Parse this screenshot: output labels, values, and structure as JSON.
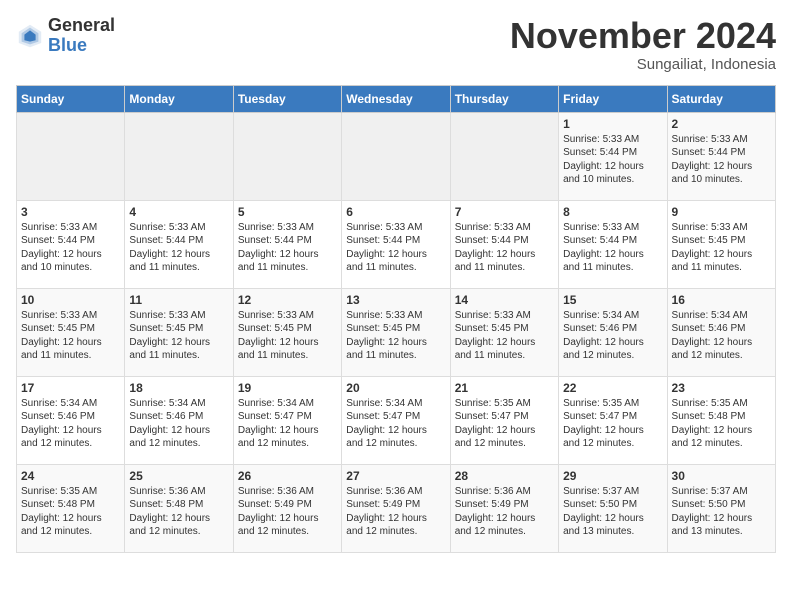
{
  "header": {
    "logo_general": "General",
    "logo_blue": "Blue",
    "month_title": "November 2024",
    "location": "Sungailiat, Indonesia"
  },
  "days_of_week": [
    "Sunday",
    "Monday",
    "Tuesday",
    "Wednesday",
    "Thursday",
    "Friday",
    "Saturday"
  ],
  "weeks": [
    [
      {
        "day": "",
        "text": ""
      },
      {
        "day": "",
        "text": ""
      },
      {
        "day": "",
        "text": ""
      },
      {
        "day": "",
        "text": ""
      },
      {
        "day": "",
        "text": ""
      },
      {
        "day": "1",
        "text": "Sunrise: 5:33 AM\nSunset: 5:44 PM\nDaylight: 12 hours\nand 10 minutes."
      },
      {
        "day": "2",
        "text": "Sunrise: 5:33 AM\nSunset: 5:44 PM\nDaylight: 12 hours\nand 10 minutes."
      }
    ],
    [
      {
        "day": "3",
        "text": "Sunrise: 5:33 AM\nSunset: 5:44 PM\nDaylight: 12 hours\nand 10 minutes."
      },
      {
        "day": "4",
        "text": "Sunrise: 5:33 AM\nSunset: 5:44 PM\nDaylight: 12 hours\nand 11 minutes."
      },
      {
        "day": "5",
        "text": "Sunrise: 5:33 AM\nSunset: 5:44 PM\nDaylight: 12 hours\nand 11 minutes."
      },
      {
        "day": "6",
        "text": "Sunrise: 5:33 AM\nSunset: 5:44 PM\nDaylight: 12 hours\nand 11 minutes."
      },
      {
        "day": "7",
        "text": "Sunrise: 5:33 AM\nSunset: 5:44 PM\nDaylight: 12 hours\nand 11 minutes."
      },
      {
        "day": "8",
        "text": "Sunrise: 5:33 AM\nSunset: 5:44 PM\nDaylight: 12 hours\nand 11 minutes."
      },
      {
        "day": "9",
        "text": "Sunrise: 5:33 AM\nSunset: 5:45 PM\nDaylight: 12 hours\nand 11 minutes."
      }
    ],
    [
      {
        "day": "10",
        "text": "Sunrise: 5:33 AM\nSunset: 5:45 PM\nDaylight: 12 hours\nand 11 minutes."
      },
      {
        "day": "11",
        "text": "Sunrise: 5:33 AM\nSunset: 5:45 PM\nDaylight: 12 hours\nand 11 minutes."
      },
      {
        "day": "12",
        "text": "Sunrise: 5:33 AM\nSunset: 5:45 PM\nDaylight: 12 hours\nand 11 minutes."
      },
      {
        "day": "13",
        "text": "Sunrise: 5:33 AM\nSunset: 5:45 PM\nDaylight: 12 hours\nand 11 minutes."
      },
      {
        "day": "14",
        "text": "Sunrise: 5:33 AM\nSunset: 5:45 PM\nDaylight: 12 hours\nand 11 minutes."
      },
      {
        "day": "15",
        "text": "Sunrise: 5:34 AM\nSunset: 5:46 PM\nDaylight: 12 hours\nand 12 minutes."
      },
      {
        "day": "16",
        "text": "Sunrise: 5:34 AM\nSunset: 5:46 PM\nDaylight: 12 hours\nand 12 minutes."
      }
    ],
    [
      {
        "day": "17",
        "text": "Sunrise: 5:34 AM\nSunset: 5:46 PM\nDaylight: 12 hours\nand 12 minutes."
      },
      {
        "day": "18",
        "text": "Sunrise: 5:34 AM\nSunset: 5:46 PM\nDaylight: 12 hours\nand 12 minutes."
      },
      {
        "day": "19",
        "text": "Sunrise: 5:34 AM\nSunset: 5:47 PM\nDaylight: 12 hours\nand 12 minutes."
      },
      {
        "day": "20",
        "text": "Sunrise: 5:34 AM\nSunset: 5:47 PM\nDaylight: 12 hours\nand 12 minutes."
      },
      {
        "day": "21",
        "text": "Sunrise: 5:35 AM\nSunset: 5:47 PM\nDaylight: 12 hours\nand 12 minutes."
      },
      {
        "day": "22",
        "text": "Sunrise: 5:35 AM\nSunset: 5:47 PM\nDaylight: 12 hours\nand 12 minutes."
      },
      {
        "day": "23",
        "text": "Sunrise: 5:35 AM\nSunset: 5:48 PM\nDaylight: 12 hours\nand 12 minutes."
      }
    ],
    [
      {
        "day": "24",
        "text": "Sunrise: 5:35 AM\nSunset: 5:48 PM\nDaylight: 12 hours\nand 12 minutes."
      },
      {
        "day": "25",
        "text": "Sunrise: 5:36 AM\nSunset: 5:48 PM\nDaylight: 12 hours\nand 12 minutes."
      },
      {
        "day": "26",
        "text": "Sunrise: 5:36 AM\nSunset: 5:49 PM\nDaylight: 12 hours\nand 12 minutes."
      },
      {
        "day": "27",
        "text": "Sunrise: 5:36 AM\nSunset: 5:49 PM\nDaylight: 12 hours\nand 12 minutes."
      },
      {
        "day": "28",
        "text": "Sunrise: 5:36 AM\nSunset: 5:49 PM\nDaylight: 12 hours\nand 12 minutes."
      },
      {
        "day": "29",
        "text": "Sunrise: 5:37 AM\nSunset: 5:50 PM\nDaylight: 12 hours\nand 13 minutes."
      },
      {
        "day": "30",
        "text": "Sunrise: 5:37 AM\nSunset: 5:50 PM\nDaylight: 12 hours\nand 13 minutes."
      }
    ]
  ]
}
